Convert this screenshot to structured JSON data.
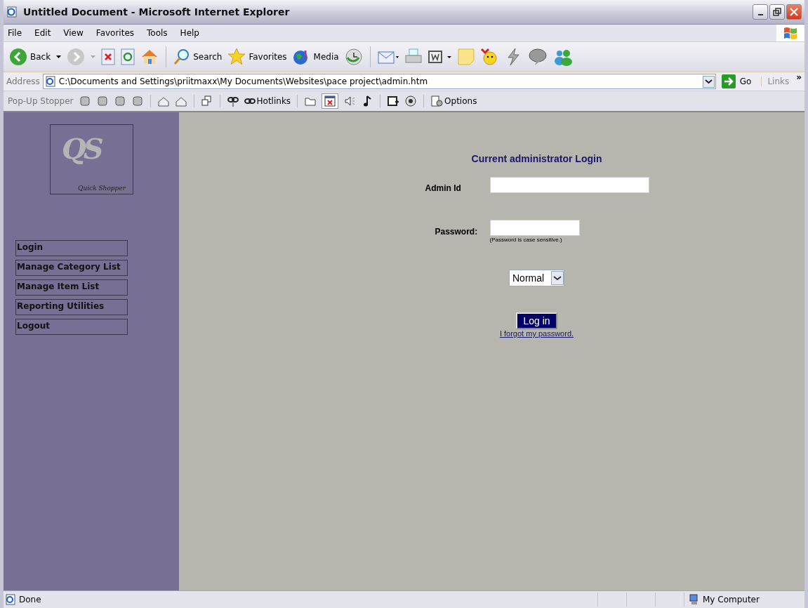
{
  "window": {
    "title": "Untitled Document - Microsoft Internet Explorer"
  },
  "menu": [
    "File",
    "Edit",
    "View",
    "Favorites",
    "Tools",
    "Help"
  ],
  "toolbar": {
    "back": "Back",
    "search": "Search",
    "favorites": "Favorites",
    "media": "Media"
  },
  "address_bar": {
    "label": "Address",
    "value": "C:\\Documents and Settings\\priitmaxx\\My Documents\\Websites\\pace project\\admin.htm",
    "go": "Go",
    "links": "Links",
    "more": "»"
  },
  "popup_stopper": {
    "label": "Pop-Up Stopper",
    "hotlinks": "Hotlinks",
    "options": "Options"
  },
  "logo": {
    "monogram": "QS",
    "name": "Quick Shopper"
  },
  "nav": [
    {
      "label": "Login"
    },
    {
      "label": "Manage Category List"
    },
    {
      "label": "Manage Item List"
    },
    {
      "label": "Reporting Utilities"
    },
    {
      "label": "Logout"
    }
  ],
  "login": {
    "heading": "Current administrator Login",
    "admin_label": "Admin Id",
    "password_label": "Password:",
    "password_hint": "(Password is case sensitive.)",
    "mode": "Normal",
    "submit": "Log in",
    "forgot": "I forgot my password."
  },
  "status_bar": {
    "text": "Done",
    "zone": "My Computer"
  }
}
